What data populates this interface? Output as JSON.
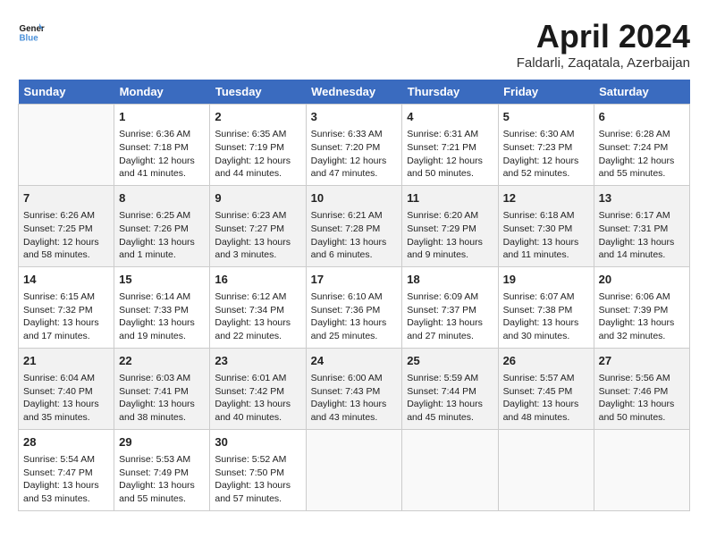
{
  "header": {
    "logo_line1": "General",
    "logo_line2": "Blue",
    "title": "April 2024",
    "subtitle": "Faldarli, Zaqatala, Azerbaijan"
  },
  "days_of_week": [
    "Sunday",
    "Monday",
    "Tuesday",
    "Wednesday",
    "Thursday",
    "Friday",
    "Saturday"
  ],
  "weeks": [
    [
      {
        "day": "",
        "info": ""
      },
      {
        "day": "1",
        "info": "Sunrise: 6:36 AM\nSunset: 7:18 PM\nDaylight: 12 hours\nand 41 minutes."
      },
      {
        "day": "2",
        "info": "Sunrise: 6:35 AM\nSunset: 7:19 PM\nDaylight: 12 hours\nand 44 minutes."
      },
      {
        "day": "3",
        "info": "Sunrise: 6:33 AM\nSunset: 7:20 PM\nDaylight: 12 hours\nand 47 minutes."
      },
      {
        "day": "4",
        "info": "Sunrise: 6:31 AM\nSunset: 7:21 PM\nDaylight: 12 hours\nand 50 minutes."
      },
      {
        "day": "5",
        "info": "Sunrise: 6:30 AM\nSunset: 7:23 PM\nDaylight: 12 hours\nand 52 minutes."
      },
      {
        "day": "6",
        "info": "Sunrise: 6:28 AM\nSunset: 7:24 PM\nDaylight: 12 hours\nand 55 minutes."
      }
    ],
    [
      {
        "day": "7",
        "info": "Sunrise: 6:26 AM\nSunset: 7:25 PM\nDaylight: 12 hours\nand 58 minutes."
      },
      {
        "day": "8",
        "info": "Sunrise: 6:25 AM\nSunset: 7:26 PM\nDaylight: 13 hours\nand 1 minute."
      },
      {
        "day": "9",
        "info": "Sunrise: 6:23 AM\nSunset: 7:27 PM\nDaylight: 13 hours\nand 3 minutes."
      },
      {
        "day": "10",
        "info": "Sunrise: 6:21 AM\nSunset: 7:28 PM\nDaylight: 13 hours\nand 6 minutes."
      },
      {
        "day": "11",
        "info": "Sunrise: 6:20 AM\nSunset: 7:29 PM\nDaylight: 13 hours\nand 9 minutes."
      },
      {
        "day": "12",
        "info": "Sunrise: 6:18 AM\nSunset: 7:30 PM\nDaylight: 13 hours\nand 11 minutes."
      },
      {
        "day": "13",
        "info": "Sunrise: 6:17 AM\nSunset: 7:31 PM\nDaylight: 13 hours\nand 14 minutes."
      }
    ],
    [
      {
        "day": "14",
        "info": "Sunrise: 6:15 AM\nSunset: 7:32 PM\nDaylight: 13 hours\nand 17 minutes."
      },
      {
        "day": "15",
        "info": "Sunrise: 6:14 AM\nSunset: 7:33 PM\nDaylight: 13 hours\nand 19 minutes."
      },
      {
        "day": "16",
        "info": "Sunrise: 6:12 AM\nSunset: 7:34 PM\nDaylight: 13 hours\nand 22 minutes."
      },
      {
        "day": "17",
        "info": "Sunrise: 6:10 AM\nSunset: 7:36 PM\nDaylight: 13 hours\nand 25 minutes."
      },
      {
        "day": "18",
        "info": "Sunrise: 6:09 AM\nSunset: 7:37 PM\nDaylight: 13 hours\nand 27 minutes."
      },
      {
        "day": "19",
        "info": "Sunrise: 6:07 AM\nSunset: 7:38 PM\nDaylight: 13 hours\nand 30 minutes."
      },
      {
        "day": "20",
        "info": "Sunrise: 6:06 AM\nSunset: 7:39 PM\nDaylight: 13 hours\nand 32 minutes."
      }
    ],
    [
      {
        "day": "21",
        "info": "Sunrise: 6:04 AM\nSunset: 7:40 PM\nDaylight: 13 hours\nand 35 minutes."
      },
      {
        "day": "22",
        "info": "Sunrise: 6:03 AM\nSunset: 7:41 PM\nDaylight: 13 hours\nand 38 minutes."
      },
      {
        "day": "23",
        "info": "Sunrise: 6:01 AM\nSunset: 7:42 PM\nDaylight: 13 hours\nand 40 minutes."
      },
      {
        "day": "24",
        "info": "Sunrise: 6:00 AM\nSunset: 7:43 PM\nDaylight: 13 hours\nand 43 minutes."
      },
      {
        "day": "25",
        "info": "Sunrise: 5:59 AM\nSunset: 7:44 PM\nDaylight: 13 hours\nand 45 minutes."
      },
      {
        "day": "26",
        "info": "Sunrise: 5:57 AM\nSunset: 7:45 PM\nDaylight: 13 hours\nand 48 minutes."
      },
      {
        "day": "27",
        "info": "Sunrise: 5:56 AM\nSunset: 7:46 PM\nDaylight: 13 hours\nand 50 minutes."
      }
    ],
    [
      {
        "day": "28",
        "info": "Sunrise: 5:54 AM\nSunset: 7:47 PM\nDaylight: 13 hours\nand 53 minutes."
      },
      {
        "day": "29",
        "info": "Sunrise: 5:53 AM\nSunset: 7:49 PM\nDaylight: 13 hours\nand 55 minutes."
      },
      {
        "day": "30",
        "info": "Sunrise: 5:52 AM\nSunset: 7:50 PM\nDaylight: 13 hours\nand 57 minutes."
      },
      {
        "day": "",
        "info": ""
      },
      {
        "day": "",
        "info": ""
      },
      {
        "day": "",
        "info": ""
      },
      {
        "day": "",
        "info": ""
      }
    ]
  ]
}
